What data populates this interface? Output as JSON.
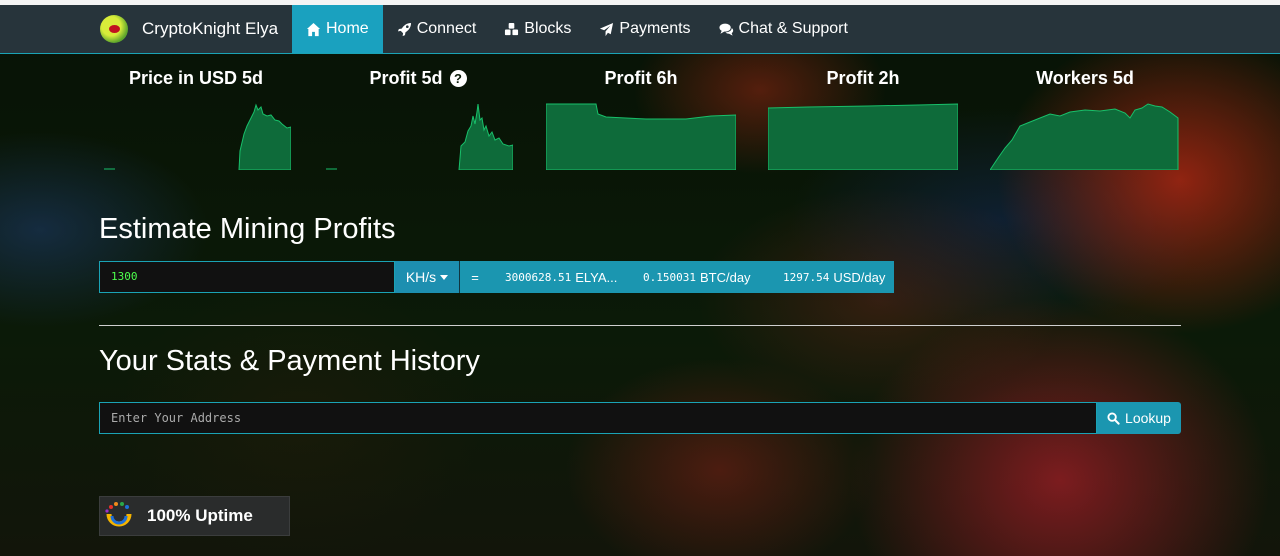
{
  "nav": {
    "brand": "CryptoKnight Elya",
    "items": [
      {
        "label": "Home",
        "icon": "home-icon",
        "active": true
      },
      {
        "label": "Connect",
        "icon": "rocket-icon"
      },
      {
        "label": "Blocks",
        "icon": "cubes-icon"
      },
      {
        "label": "Payments",
        "icon": "paper-plane-icon"
      },
      {
        "label": "Chat & Support",
        "icon": "comments-icon"
      }
    ]
  },
  "charts": {
    "price_usd_5d": "Price in USD 5d",
    "profit_5d": "Profit 5d",
    "profit_6h": "Profit 6h",
    "profit_2h": "Profit 2h",
    "workers_5d": "Workers 5d"
  },
  "estimate": {
    "title": "Estimate Mining Profits",
    "hashrate_value": "1300",
    "unit": "KH/s",
    "equals": "=",
    "coin_amount": "3000628.51",
    "coin_unit": "ELYA...",
    "btc_amount": "0.150031",
    "btc_unit": "BTC/day",
    "usd_amount": "1297.54",
    "usd_unit": "USD/day"
  },
  "stats": {
    "title": "Your Stats & Payment History",
    "address_placeholder": "Enter Your Address",
    "lookup_label": "Lookup"
  },
  "uptime": {
    "label": "100% Uptime"
  },
  "colors": {
    "accent": "#1b96b0",
    "nav_bg": "#27343b",
    "chart_fill": "#0e6b3a",
    "chart_line": "#18c06a"
  }
}
